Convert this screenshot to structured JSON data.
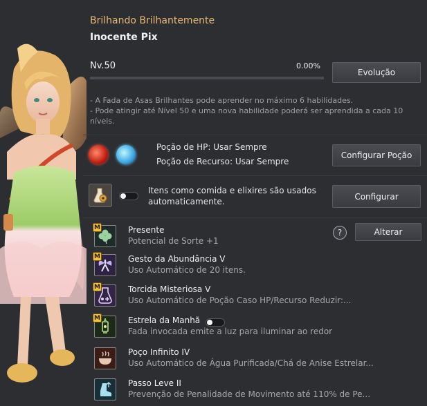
{
  "header": {
    "title": "Brilhando Brilhantemente",
    "subtitle": "Inocente Pix"
  },
  "level": {
    "label": "Nv.50",
    "percent_text": "0.00%",
    "progress_fraction": 0.0,
    "evolve_button": "Evolução"
  },
  "description": {
    "line1": "- A Fada de Asas Brilhantes pode aprender no máximo 6 habilidades.",
    "line2": "- Pode atingir até Nível 50 e uma nova habilidade poderá ser aprendida a cada 10 níveis."
  },
  "potions": {
    "hp_text": "Poção de HP: Usar Sempre",
    "resource_text": "Poção de Recurso: Usar Sempre",
    "config_button": "Configurar Poção"
  },
  "auto_use": {
    "text": "Itens como comida e elixires são usados automaticamente.",
    "config_button": "Configurar"
  },
  "skills": [
    {
      "badge": "M",
      "name": "Presente",
      "desc": "Potencial de Sorte +1",
      "icon": "clover-icon"
    },
    {
      "badge": "M",
      "name": "Gesto da Abundância V",
      "desc": "Uso Automático de 20 itens.",
      "icon": "fairy-icon"
    },
    {
      "badge": "M",
      "name": "Torcida Misteriosa V",
      "desc": "Uso Automático de Poção Caso HP/Recurso Reduzir:...",
      "icon": "flask-icon"
    },
    {
      "badge": "M",
      "name": "Estrela da Manhã",
      "desc": "Fada invocada emite a luz para iluminar ao redor",
      "icon": "lantern-icon"
    },
    {
      "badge": "",
      "name": "Poço Infinito IV",
      "desc": "Uso Automático de Água Purificada/Chá de Anise Estrelar...",
      "icon": "bowl-icon"
    },
    {
      "badge": "",
      "name": "Passo Leve II",
      "desc": "Prevenção de Penalidade de Movimento até 110% de Pe...",
      "icon": "boot-icon"
    }
  ],
  "skill_actions": {
    "help": "?",
    "change_button": "Alterar"
  }
}
